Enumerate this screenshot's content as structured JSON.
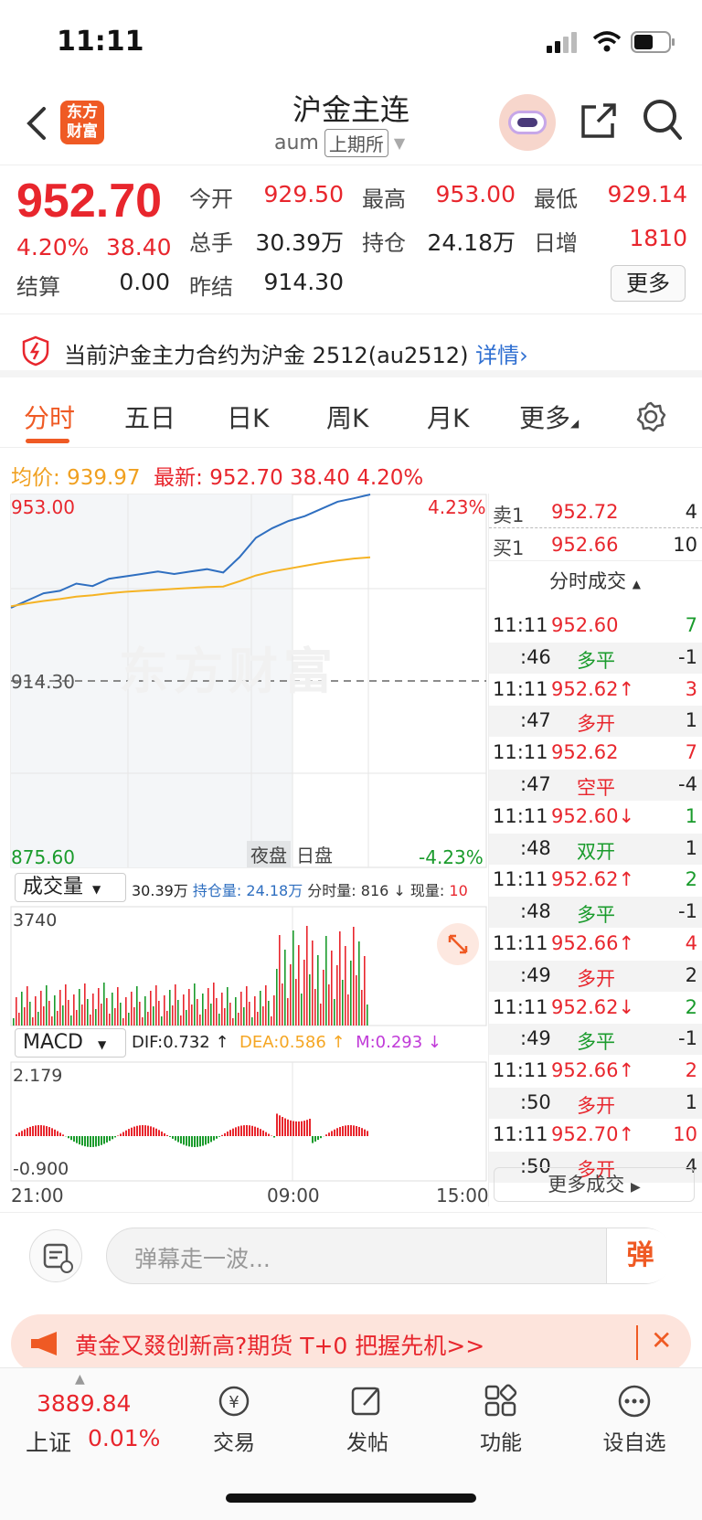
{
  "status": {
    "time": "11:11"
  },
  "header": {
    "title": "沪金主连",
    "code": "aum",
    "exchange": "上期所",
    "logo_text": "东方财富"
  },
  "quote": {
    "price": "952.70",
    "change_pct": "4.20%",
    "change": "38.40",
    "open_label": "今开",
    "open": "929.50",
    "high_label": "最高",
    "high": "953.00",
    "low_label": "最低",
    "low": "929.14",
    "volume_label": "总手",
    "volume": "30.39万",
    "position_label": "持仓",
    "position": "24.18万",
    "daily_inc_label": "日增",
    "daily_inc": "1810",
    "settle_label": "结算",
    "settle": "0.00",
    "prev_settle_label": "昨结",
    "prev_settle": "914.30",
    "more_label": "更多"
  },
  "notice": {
    "text": "当前沪金主力合约为沪金 2512(au2512) ",
    "link": "详情"
  },
  "tabs": [
    "分时",
    "五日",
    "日K",
    "周K",
    "月K",
    "更多"
  ],
  "summary": {
    "avg_label": "均价:",
    "avg": "939.97",
    "last_label": "最新:",
    "last": "952.70",
    "change": "38.40",
    "pct": "4.20%"
  },
  "chart_labels": {
    "top_price": "953.00",
    "mid_price": "914.30",
    "bottom_price": "875.60",
    "top_pct": "4.23%",
    "bottom_pct": "-4.23%",
    "night": "夜盘",
    "day": "日盘",
    "watermark": "东方财富",
    "vol_select": "成交量",
    "vol_info": "30.39万",
    "pos_info": "持仓量: 24.18万",
    "min_vol": "分时量: 816 ↓",
    "cur_vol_label": "现量:",
    "cur_vol": "10",
    "vol_max": "3740",
    "macd_select": "MACD",
    "dif": "DIF:0.732 ↑",
    "dea": "DEA:0.586 ↑",
    "m": "M:0.293 ↓",
    "macd_top": "2.179",
    "macd_bottom": "-0.900",
    "x_start": "21:00",
    "x_mid": "09:00",
    "x_end": "15:00"
  },
  "order_book": [
    {
      "label": "卖1",
      "price": "952.72",
      "vol": "4"
    },
    {
      "label": "买1",
      "price": "952.66",
      "vol": "10"
    }
  ],
  "ticks_title": "分时成交",
  "ticks": [
    {
      "time": "11:11",
      "price": "952.60",
      "vol": "7",
      "vol_color": "green"
    },
    {
      "time": ":46",
      "kind": "多平",
      "kind_color": "green",
      "vol": "-1",
      "vol_color": "dark"
    },
    {
      "time": "11:11",
      "price": "952.62↑",
      "vol": "3",
      "vol_color": "red"
    },
    {
      "time": ":47",
      "kind": "多开",
      "kind_color": "red",
      "vol": "1",
      "vol_color": "dark"
    },
    {
      "time": "11:11",
      "price": "952.62",
      "vol": "7",
      "vol_color": "red"
    },
    {
      "time": ":47",
      "kind": "空平",
      "kind_color": "red",
      "vol": "-4",
      "vol_color": "dark"
    },
    {
      "time": "11:11",
      "price": "952.60↓",
      "vol": "1",
      "vol_color": "green"
    },
    {
      "time": ":48",
      "kind": "双开",
      "kind_color": "green",
      "vol": "1",
      "vol_color": "dark"
    },
    {
      "time": "11:11",
      "price": "952.62↑",
      "vol": "2",
      "vol_color": "green"
    },
    {
      "time": ":48",
      "kind": "多平",
      "kind_color": "green",
      "vol": "-1",
      "vol_color": "dark"
    },
    {
      "time": "11:11",
      "price": "952.66↑",
      "vol": "4",
      "vol_color": "red"
    },
    {
      "time": ":49",
      "kind": "多开",
      "kind_color": "red",
      "vol": "2",
      "vol_color": "dark"
    },
    {
      "time": "11:11",
      "price": "952.62↓",
      "vol": "2",
      "vol_color": "green"
    },
    {
      "time": ":49",
      "kind": "多平",
      "kind_color": "green",
      "vol": "-1",
      "vol_color": "dark"
    },
    {
      "time": "11:11",
      "price": "952.66↑",
      "vol": "2",
      "vol_color": "red"
    },
    {
      "time": ":50",
      "kind": "多开",
      "kind_color": "red",
      "vol": "1",
      "vol_color": "dark"
    },
    {
      "time": "11:11",
      "price": "952.70↑",
      "vol": "10",
      "vol_color": "red"
    },
    {
      "time": ":50",
      "kind": "多开",
      "kind_color": "red",
      "vol": "4",
      "vol_color": "dark"
    }
  ],
  "more_deals": "更多成交",
  "comment": {
    "placeholder": "弹幕走一波...",
    "danmu_icon": "弹"
  },
  "promo": {
    "text": "黄金又叕创新高?期货 T+0 把握先机>>"
  },
  "tabbar": {
    "index_value": "3889.84",
    "index_name": "上证",
    "index_pct": "0.01%",
    "items": [
      "交易",
      "发帖",
      "功能",
      "设自选"
    ]
  },
  "colors": {
    "up": "#e8262d",
    "down": "#1a9b2c",
    "accent": "#ef5a24",
    "price_line": "#2f6fc0",
    "avg_line": "#f5b324"
  },
  "chart_data": {
    "type": "line",
    "title": "",
    "xlabel": "",
    "ylabel": "",
    "x_ticks": [
      "21:00",
      "09:00",
      "15:00"
    ],
    "ylim": [
      875.6,
      953.0
    ],
    "series": [
      {
        "name": "最新",
        "color": "#2f6fc0",
        "values": [
          929.5,
          931.0,
          932.5,
          933.0,
          934.5,
          934.0,
          935.5,
          936.0,
          936.5,
          937.0,
          936.5,
          937.0,
          937.5,
          936.8,
          940.0,
          944.0,
          946.0,
          947.5,
          948.5,
          950.0,
          951.5,
          952.2,
          953.0
        ]
      },
      {
        "name": "均价",
        "color": "#f5b324",
        "values": [
          929.8,
          930.4,
          930.9,
          931.3,
          931.8,
          932.1,
          932.5,
          932.8,
          933.0,
          933.2,
          933.4,
          933.6,
          933.8,
          933.9,
          935.0,
          936.2,
          937.0,
          937.6,
          938.2,
          938.8,
          939.3,
          939.7,
          939.97
        ]
      }
    ]
  }
}
